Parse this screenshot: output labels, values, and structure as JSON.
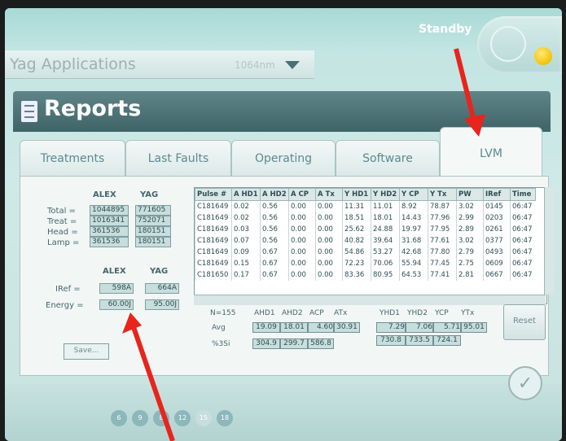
{
  "header": {
    "status": "Standby"
  },
  "app": {
    "title": "Yag Applications",
    "wavelength": "1064nm"
  },
  "page": {
    "title": "Reports"
  },
  "tabs": [
    {
      "label": "Treatments"
    },
    {
      "label": "Last Faults"
    },
    {
      "label": "Operating"
    },
    {
      "label": "Software"
    },
    {
      "label": "LVM"
    }
  ],
  "counters": {
    "col_alex": "ALEX",
    "col_yag": "YAG",
    "rows": [
      {
        "label": "Total =",
        "alex": "1044895",
        "yag": "771605"
      },
      {
        "label": "Treat =",
        "alex": "1016341",
        "yag": "752071"
      },
      {
        "label": "Head =",
        "alex": "361536",
        "yag": "180151"
      },
      {
        "label": "Lamp =",
        "alex": "361536",
        "yag": "180151"
      }
    ]
  },
  "calibration": {
    "col_alex": "ALEX",
    "col_yag": "YAG",
    "iref_label": "IRef =",
    "iref_alex": "598A",
    "iref_yag": "664A",
    "energy_label": "Energy =",
    "energy_alex": "60.00J",
    "energy_yag": "95.00J"
  },
  "save_label": "Save...",
  "table": {
    "headers": [
      "Pulse #",
      "A HD1",
      "A HD2",
      "A CP",
      "A Tx",
      "Y HD1",
      "Y HD2",
      "Y CP",
      "Y Tx",
      "PW",
      "IRef",
      "Time"
    ],
    "rows": [
      [
        "C181649",
        "0.02",
        "0.56",
        "0.00",
        "0.00",
        "11.31",
        "11.01",
        "8.92",
        "78.87",
        "3.02",
        "0145",
        "06:47"
      ],
      [
        "C181649",
        "0.02",
        "0.56",
        "0.00",
        "0.00",
        "18.51",
        "18.01",
        "14.43",
        "77.96",
        "2.99",
        "0203",
        "06:47"
      ],
      [
        "C181649",
        "0.03",
        "0.56",
        "0.00",
        "0.00",
        "25.62",
        "24.88",
        "19.97",
        "77.95",
        "2.89",
        "0261",
        "06:47"
      ],
      [
        "C181649",
        "0.07",
        "0.56",
        "0.00",
        "0.00",
        "40.82",
        "39.64",
        "31.68",
        "77.61",
        "3.02",
        "0377",
        "06:47"
      ],
      [
        "C181649",
        "0.09",
        "0.67",
        "0.00",
        "0.00",
        "54.86",
        "53.27",
        "42.68",
        "77.80",
        "2.79",
        "0493",
        "06:47"
      ],
      [
        "C181649",
        "0.15",
        "0.67",
        "0.00",
        "0.00",
        "72.23",
        "70.06",
        "55.94",
        "77.45",
        "2.75",
        "0609",
        "06:47"
      ],
      [
        "C181650",
        "0.17",
        "0.67",
        "0.00",
        "0.00",
        "83.36",
        "80.95",
        "64.53",
        "77.41",
        "2.81",
        "0667",
        "06:47"
      ]
    ]
  },
  "stats": {
    "n": "N=155",
    "a_headers": [
      "AHD1",
      "AHD2",
      "ACP",
      "ATx"
    ],
    "y_headers": [
      "YHD1",
      "YHD2",
      "YCP",
      "YTx"
    ],
    "avg_label": "Avg",
    "si_label": "%3Si",
    "avg_a": [
      "19.09",
      "18.01",
      "4.60",
      "30.91"
    ],
    "avg_y": [
      "7.29",
      "7.06",
      "5.71",
      "95.01"
    ],
    "si_a": [
      "304.9",
      "299.7",
      "586.8"
    ],
    "si_y": [
      "730.8",
      "733.5",
      "724.1"
    ]
  },
  "reset_label": "Reset",
  "pager": [
    "6",
    "9",
    "8",
    "12",
    "15",
    "18"
  ]
}
